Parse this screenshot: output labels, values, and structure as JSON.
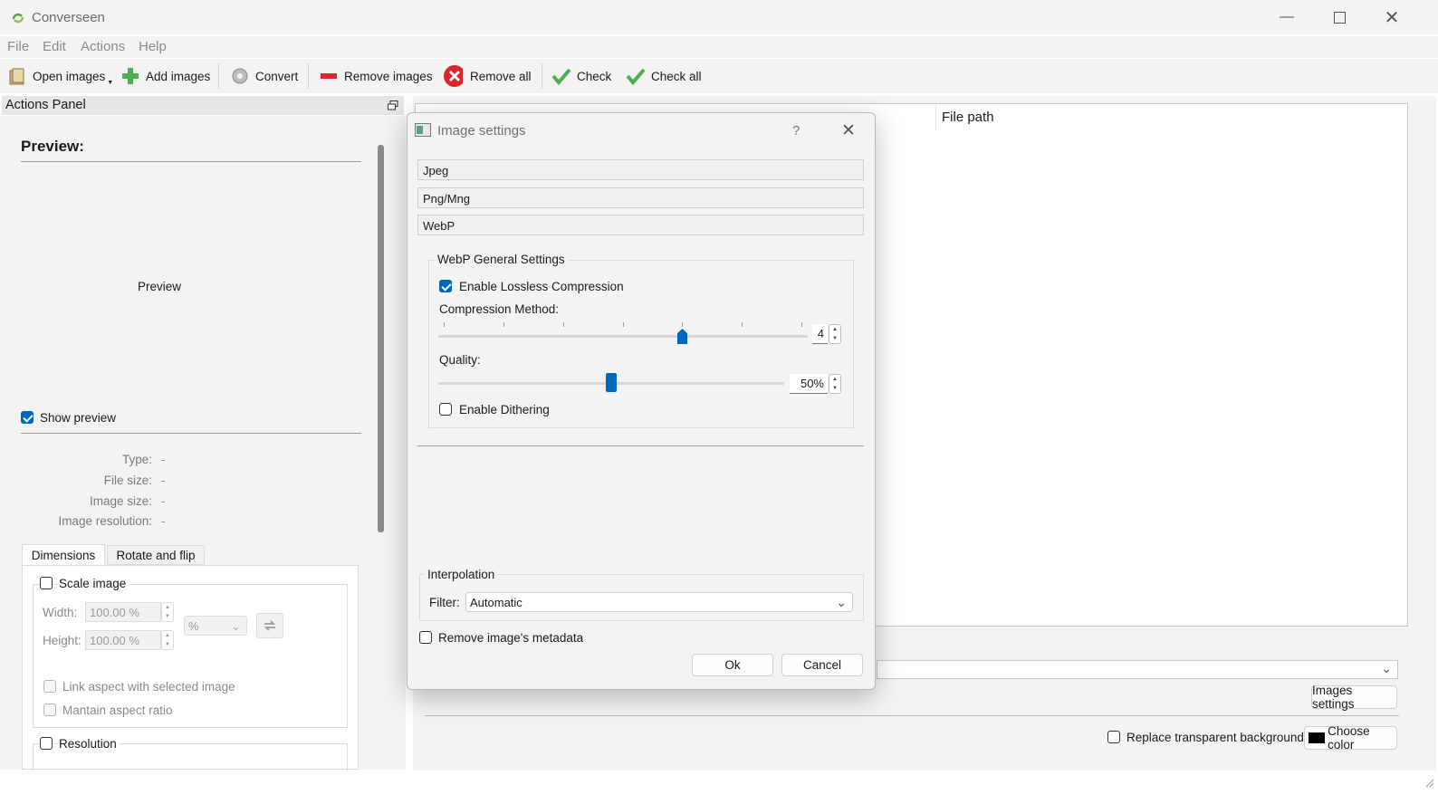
{
  "window": {
    "title": "Converseen"
  },
  "menu": [
    "File",
    "Edit",
    "Actions",
    "Help"
  ],
  "toolbar": {
    "open_images": "Open images",
    "add_images": "Add images",
    "convert": "Convert",
    "remove_images": "Remove images",
    "remove_all": "Remove all",
    "check": "Check",
    "check_all": "Check all"
  },
  "actions_panel": {
    "title": "Actions Panel",
    "preview_heading": "Preview:",
    "preview_placeholder": "Preview",
    "show_preview": "Show preview",
    "show_preview_checked": true,
    "info": [
      {
        "key": "Type:",
        "value": "-"
      },
      {
        "key": "File size:",
        "value": "-"
      },
      {
        "key": "Image size:",
        "value": "-"
      },
      {
        "key": "Image resolution:",
        "value": "-"
      }
    ],
    "tabs": [
      "Dimensions",
      "Rotate and flip"
    ],
    "active_tab": "Dimensions",
    "scale_image": "Scale image",
    "width_label": "Width:",
    "width_value": "100.00 %",
    "height_label": "Height:",
    "height_value": "100.00 %",
    "unit": "%",
    "link_aspect": "Link aspect with selected image",
    "maintain_aspect": "Mantain aspect ratio",
    "resolution": "Resolution"
  },
  "main": {
    "file_path_header": "File path",
    "images_settings_button": "Images settings",
    "replace_transparent": "Replace transparent background",
    "choose_color": "Choose color",
    "color_swatch": "#000000"
  },
  "dialog": {
    "title": "Image settings",
    "help": "?",
    "sections": [
      "Jpeg",
      "Png/Mng",
      "WebP"
    ],
    "webp_group": "WebP General Settings",
    "enable_lossless": "Enable Lossless Compression",
    "enable_lossless_checked": true,
    "compression_method_label": "Compression Method:",
    "compression_method_value": "4",
    "compression_method_min": 0,
    "compression_method_max": 6,
    "quality_label": "Quality:",
    "quality_value": "50%",
    "quality_fraction": 0.5,
    "enable_dithering": "Enable Dithering",
    "enable_dithering_checked": false,
    "interpolation_group": "Interpolation",
    "filter_label": "Filter:",
    "filter_value": "Automatic",
    "remove_metadata": "Remove image's metadata",
    "remove_metadata_checked": false,
    "ok": "Ok",
    "cancel": "Cancel"
  },
  "colors": {
    "accent": "#0067c0",
    "remove_red": "#d9262c",
    "check_green": "#4caf50"
  }
}
